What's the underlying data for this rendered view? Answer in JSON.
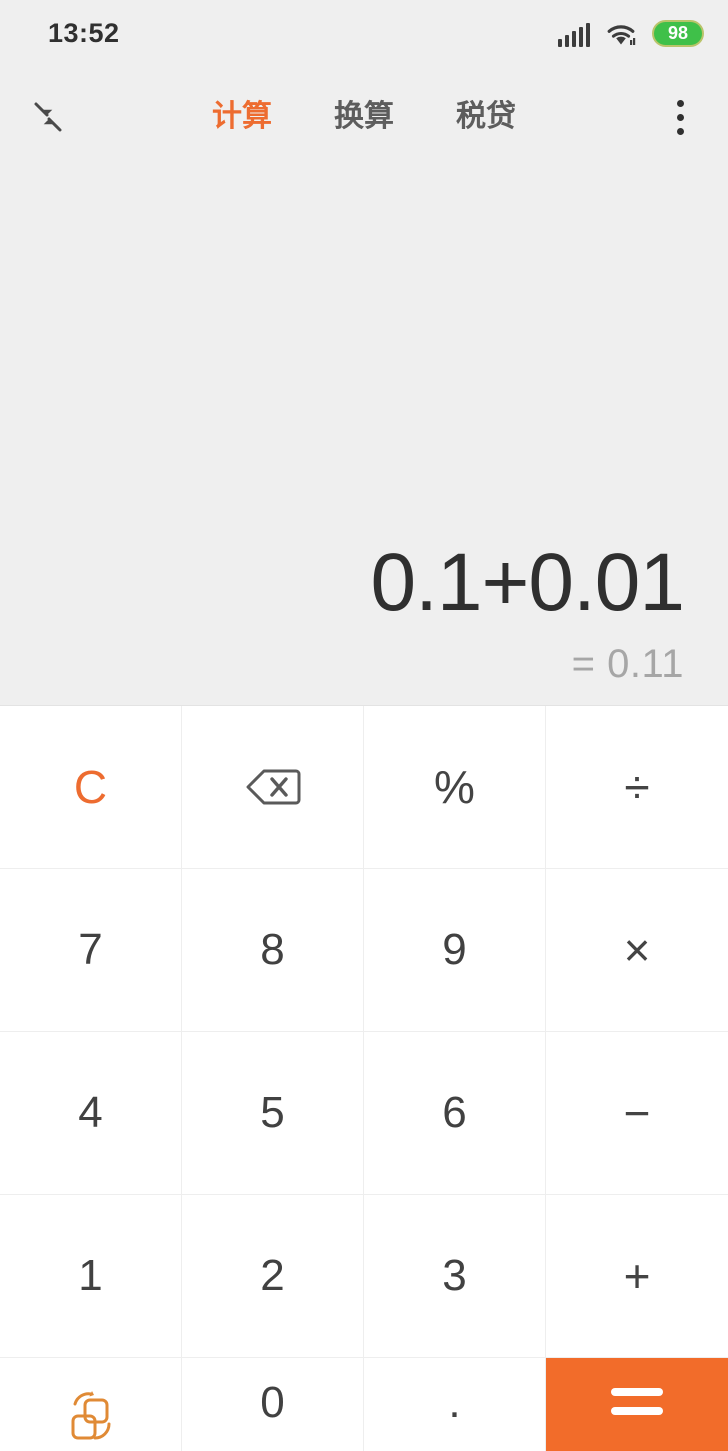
{
  "status_bar": {
    "time": "13:52",
    "signal_icon": "cellular-signal-icon",
    "wifi_icon": "wifi-icon",
    "battery_icon": "battery-icon",
    "battery_level": "98",
    "battery_color": "#3fc049"
  },
  "app_bar": {
    "collapse_icon": "collapse-arrows-icon",
    "menu_icon": "overflow-menu-icon",
    "active_tab_color": "#ed6c30",
    "inactive_tab_color": "#5d5d5d",
    "tabs": [
      {
        "label": "计算",
        "active": true
      },
      {
        "label": "换算",
        "active": false
      },
      {
        "label": "税贷",
        "active": false
      }
    ]
  },
  "display": {
    "expression": "0.1+0.01",
    "result": "= 0.11",
    "background": "#efefef"
  },
  "keypad": {
    "accent_color": "#f26c2a",
    "keys": [
      {
        "label": "C",
        "name": "key-clear",
        "type": "clear"
      },
      {
        "label": "",
        "name": "key-backspace",
        "type": "icon",
        "icon": "backspace-icon"
      },
      {
        "label": "%",
        "name": "key-percent",
        "type": "op"
      },
      {
        "label": "÷",
        "name": "key-divide",
        "type": "op"
      },
      {
        "label": "7",
        "name": "key-7",
        "type": "digit"
      },
      {
        "label": "8",
        "name": "key-8",
        "type": "digit"
      },
      {
        "label": "9",
        "name": "key-9",
        "type": "digit"
      },
      {
        "label": "×",
        "name": "key-multiply",
        "type": "op"
      },
      {
        "label": "4",
        "name": "key-4",
        "type": "digit"
      },
      {
        "label": "5",
        "name": "key-5",
        "type": "digit"
      },
      {
        "label": "6",
        "name": "key-6",
        "type": "digit"
      },
      {
        "label": "−",
        "name": "key-subtract",
        "type": "op"
      },
      {
        "label": "1",
        "name": "key-1",
        "type": "digit"
      },
      {
        "label": "2",
        "name": "key-2",
        "type": "digit"
      },
      {
        "label": "3",
        "name": "key-3",
        "type": "digit"
      },
      {
        "label": "+",
        "name": "key-add",
        "type": "op"
      },
      {
        "label": "",
        "name": "key-unit-convert",
        "type": "icon",
        "icon": "unit-convert-icon"
      },
      {
        "label": "0",
        "name": "key-0",
        "type": "digit"
      },
      {
        "label": ".",
        "name": "key-decimal",
        "type": "digit"
      },
      {
        "label": "=",
        "name": "key-equals",
        "type": "equals",
        "icon": "equals-icon"
      }
    ]
  }
}
